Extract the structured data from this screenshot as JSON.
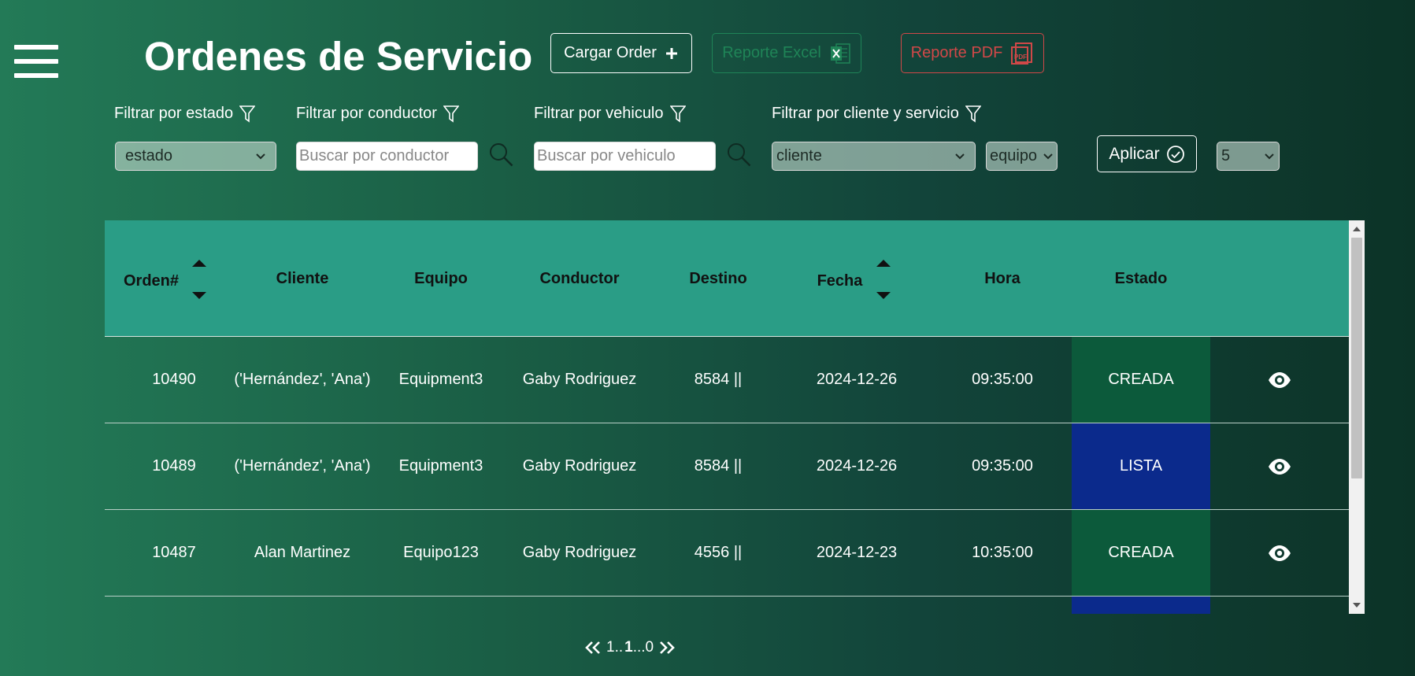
{
  "header": {
    "title": "Ordenes de Servicio",
    "cargar_label": "Cargar Order",
    "excel_label": "Reporte Excel",
    "pdf_label": "Reporte PDF"
  },
  "filters": {
    "estado_label": "Filtrar por estado",
    "conductor_label": "Filtrar por conductor",
    "vehiculo_label": "Filtrar por vehiculo",
    "cliente_label": "Filtrar por cliente y servicio",
    "estado_value": "estado",
    "conductor_placeholder": "Buscar por conductor",
    "vehiculo_placeholder": "Buscar por vehiculo",
    "cliente_value": "cliente",
    "equipo_value": "equipo",
    "aplicar_label": "Aplicar",
    "page_size_value": "5"
  },
  "table": {
    "columns": [
      "Orden#",
      "Cliente",
      "Equipo",
      "Conductor",
      "Destino",
      "Fecha",
      "Hora",
      "Estado"
    ],
    "rows": [
      {
        "orden": "10490",
        "cliente": "('Hernández', 'Ana')",
        "equipo": "Equipment3",
        "conductor": "Gaby Rodriguez",
        "destino": "8584 ||",
        "fecha": "2024-12-26",
        "hora": "09:35:00",
        "estado": "CREADA"
      },
      {
        "orden": "10489",
        "cliente": "('Hernández', 'Ana')",
        "equipo": "Equipment3",
        "conductor": "Gaby Rodriguez",
        "destino": "8584 ||",
        "fecha": "2024-12-26",
        "hora": "09:35:00",
        "estado": "LISTA"
      },
      {
        "orden": "10487",
        "cliente": "Alan Martinez",
        "equipo": "Equipo123",
        "conductor": "Gaby Rodriguez",
        "destino": "4556 ||",
        "fecha": "2024-12-23",
        "hora": "10:35:00",
        "estado": "CREADA"
      }
    ]
  },
  "status_colors": {
    "CREADA": "#0c5a3b",
    "LISTA": "#0b2a8c"
  },
  "pagination": {
    "prefix": "1..",
    "current": "1",
    "suffix": "...0"
  }
}
